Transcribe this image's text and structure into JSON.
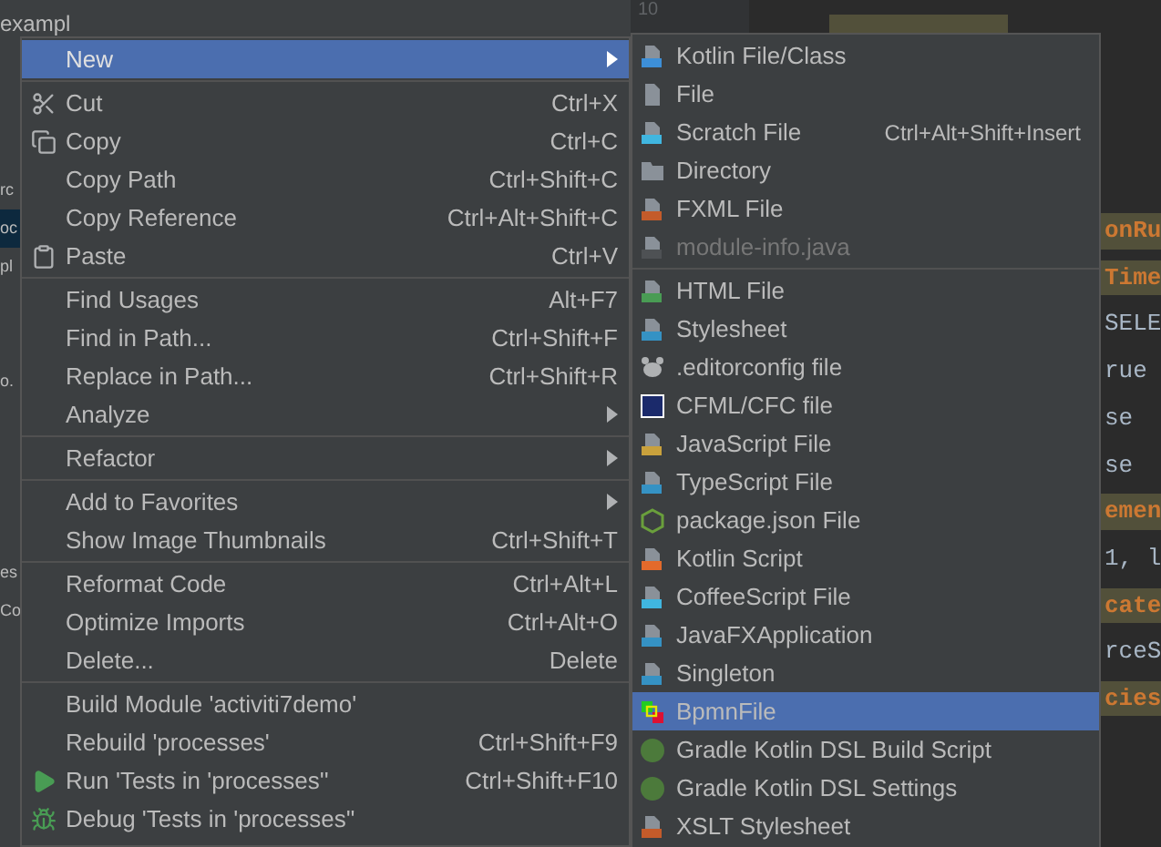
{
  "project_tree": {
    "header": "exampl",
    "items": [
      {
        "text": "rc",
        "selected": false
      },
      {
        "text": "oc",
        "selected": true
      },
      {
        "text": "pl",
        "selected": false
      },
      {
        "text": "o.",
        "selected": false
      },
      {
        "text": "es",
        "selected": false
      },
      {
        "text": "Co",
        "selected": false
      }
    ]
  },
  "editor": {
    "line_number": "10",
    "code_lines": [
      {
        "text": "onRu",
        "kind": "highlight"
      },
      {
        "text": "Time",
        "kind": "highlight"
      },
      {
        "text": "SELE",
        "kind": "plain"
      },
      {
        "text": "rue",
        "kind": "plain"
      },
      {
        "text": "se",
        "kind": "plain"
      },
      {
        "text": "se",
        "kind": "plain"
      },
      {
        "text": "emen",
        "kind": "highlight"
      },
      {
        "text": "1, l",
        "kind": "plain"
      },
      {
        "text": "cate",
        "kind": "highlight"
      },
      {
        "text": "rceS",
        "kind": "plain"
      },
      {
        "text": "cies",
        "kind": "highlight"
      }
    ]
  },
  "context_menu": {
    "groups": [
      [
        {
          "label": "New",
          "submenu": true,
          "selected": true
        }
      ],
      [
        {
          "label": "Cut",
          "shortcut": "Ctrl+X",
          "submenu": false,
          "selected": false
        },
        {
          "label": "Copy",
          "shortcut": "Ctrl+C",
          "submenu": false,
          "selected": false
        },
        {
          "label": "Copy Path",
          "shortcut": "Ctrl+Shift+C",
          "submenu": false,
          "selected": false
        },
        {
          "label": "Copy Reference",
          "shortcut": "Ctrl+Alt+Shift+C",
          "submenu": false,
          "selected": false
        },
        {
          "label": "Paste",
          "shortcut": "Ctrl+V",
          "submenu": false,
          "selected": false
        }
      ],
      [
        {
          "label": "Find Usages",
          "shortcut": "Alt+F7",
          "submenu": false,
          "selected": false
        },
        {
          "label": "Find in Path...",
          "shortcut": "Ctrl+Shift+F",
          "submenu": false,
          "selected": false
        },
        {
          "label": "Replace in Path...",
          "shortcut": "Ctrl+Shift+R",
          "submenu": false,
          "selected": false
        },
        {
          "label": "Analyze",
          "submenu": true,
          "selected": false
        }
      ],
      [
        {
          "label": "Refactor",
          "submenu": true,
          "selected": false
        }
      ],
      [
        {
          "label": "Add to Favorites",
          "submenu": true,
          "selected": false
        },
        {
          "label": "Show Image Thumbnails",
          "shortcut": "Ctrl+Shift+T",
          "submenu": false,
          "selected": false
        }
      ],
      [
        {
          "label": "Reformat Code",
          "shortcut": "Ctrl+Alt+L",
          "submenu": false,
          "selected": false
        },
        {
          "label": "Optimize Imports",
          "shortcut": "Ctrl+Alt+O",
          "submenu": false,
          "selected": false
        },
        {
          "label": "Delete...",
          "shortcut": "Delete",
          "submenu": false,
          "selected": false
        }
      ],
      [
        {
          "label": "Build Module 'activiti7demo'",
          "submenu": false,
          "selected": false
        },
        {
          "label": "Rebuild 'processes'",
          "shortcut": "Ctrl+Shift+F9",
          "submenu": false,
          "selected": false
        },
        {
          "label": "Run 'Tests in 'processes''",
          "shortcut": "Ctrl+Shift+F10",
          "submenu": false,
          "selected": false
        },
        {
          "label": "Debug 'Tests in 'processes''",
          "submenu": false,
          "selected": false
        }
      ]
    ]
  },
  "new_submenu": {
    "groups": [
      [
        {
          "label": "Kotlin File/Class",
          "disabled": false,
          "selected": false
        },
        {
          "label": "File",
          "disabled": false,
          "selected": false
        },
        {
          "label": "Scratch File",
          "shortcut": "Ctrl+Alt+Shift+Insert",
          "disabled": false,
          "selected": false
        },
        {
          "label": "Directory",
          "disabled": false,
          "selected": false
        },
        {
          "label": "FXML File",
          "disabled": false,
          "selected": false
        },
        {
          "label": "module-info.java",
          "disabled": true,
          "selected": false
        }
      ],
      [
        {
          "label": "HTML File",
          "disabled": false,
          "selected": false
        },
        {
          "label": "Stylesheet",
          "disabled": false,
          "selected": false
        },
        {
          "label": ".editorconfig file",
          "disabled": false,
          "selected": false
        },
        {
          "label": "CFML/CFC file",
          "disabled": false,
          "selected": false
        },
        {
          "label": "JavaScript File",
          "disabled": false,
          "selected": false
        },
        {
          "label": "TypeScript File",
          "disabled": false,
          "selected": false
        },
        {
          "label": "package.json File",
          "disabled": false,
          "selected": false
        },
        {
          "label": "Kotlin Script",
          "disabled": false,
          "selected": false
        },
        {
          "label": "CoffeeScript File",
          "disabled": false,
          "selected": false
        },
        {
          "label": "JavaFXApplication",
          "disabled": false,
          "selected": false
        },
        {
          "label": "Singleton",
          "disabled": false,
          "selected": false
        },
        {
          "label": "BpmnFile",
          "disabled": false,
          "selected": true
        },
        {
          "label": "Gradle Kotlin DSL Build Script",
          "disabled": false,
          "selected": false
        },
        {
          "label": "Gradle Kotlin DSL Settings",
          "disabled": false,
          "selected": false
        },
        {
          "label": "XSLT Stylesheet",
          "disabled": false,
          "selected": false
        }
      ]
    ]
  }
}
